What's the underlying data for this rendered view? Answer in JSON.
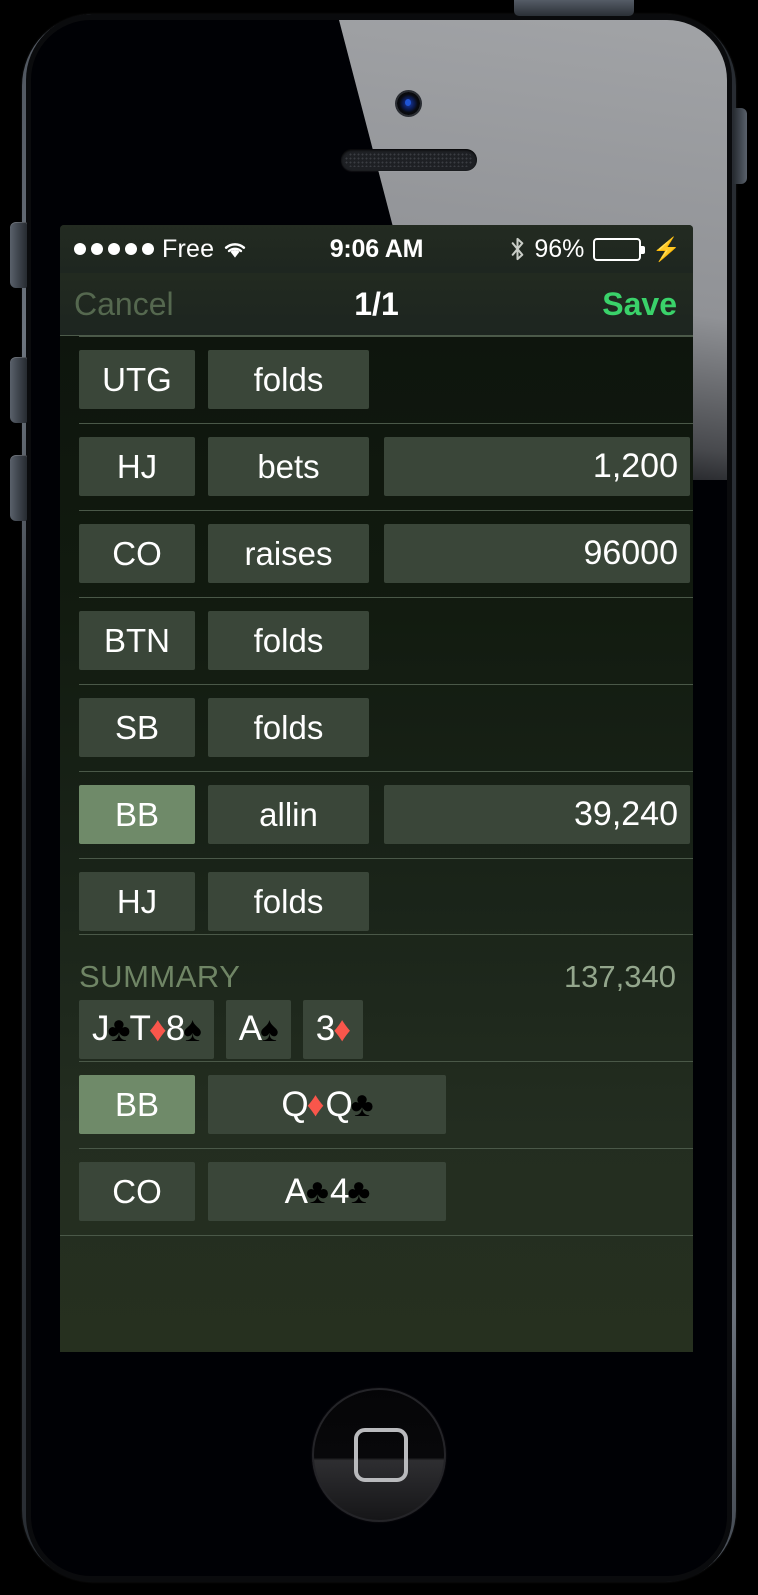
{
  "device": {
    "camera_icon": "front-camera",
    "speaker_icon": "earpiece-speaker",
    "home_icon": "home-square"
  },
  "status_bar": {
    "signal_dots": 5,
    "carrier": "Free",
    "wifi_icon": "wifi-icon",
    "time": "9:06 AM",
    "bluetooth_icon": "bluetooth-icon",
    "battery_percent": "96%",
    "battery_level": 96,
    "battery_color": "#4cd964",
    "charging_icon": "lightning-bolt-icon"
  },
  "nav_bar": {
    "cancel_label": "Cancel",
    "title": "1/1",
    "save_label": "Save",
    "save_color": "#3ad26a",
    "cancel_color": "#55684f"
  },
  "actions": [
    {
      "position": "UTG",
      "action": "folds",
      "amount": ""
    },
    {
      "position": "HJ",
      "action": "bets",
      "amount": "1,200"
    },
    {
      "position": "CO",
      "action": "raises",
      "amount": "96000"
    },
    {
      "position": "BTN",
      "action": "folds",
      "amount": ""
    },
    {
      "position": "SB",
      "action": "folds",
      "amount": ""
    },
    {
      "position": "BB",
      "action": "allin",
      "amount": "39,240",
      "highlighted": true
    },
    {
      "position": "HJ",
      "action": "folds",
      "amount": ""
    }
  ],
  "summary": {
    "label": "SUMMARY",
    "pot": "137,340",
    "board": [
      {
        "group": "flop",
        "cards": [
          {
            "rank": "J",
            "suit": "♣",
            "color": "black"
          },
          {
            "rank": "T",
            "suit": "♦",
            "color": "red"
          },
          {
            "rank": "8",
            "suit": "♠",
            "color": "black"
          }
        ]
      },
      {
        "group": "turn",
        "cards": [
          {
            "rank": "A",
            "suit": "♠",
            "color": "black"
          }
        ]
      },
      {
        "group": "river",
        "cards": [
          {
            "rank": "3",
            "suit": "♦",
            "color": "red"
          }
        ]
      }
    ],
    "showdown": [
      {
        "position": "BB",
        "highlighted": true,
        "cards": [
          {
            "rank": "Q",
            "suit": "♦",
            "color": "red"
          },
          {
            "rank": "Q",
            "suit": "♣",
            "color": "black"
          }
        ]
      },
      {
        "position": "CO",
        "highlighted": false,
        "cards": [
          {
            "rank": "A",
            "suit": "♣",
            "color": "black"
          },
          {
            "rank": "4",
            "suit": "♣",
            "color": "black"
          }
        ]
      }
    ]
  },
  "colors": {
    "chip_bg": "#3a4639",
    "chip_highlight": "#6f8a69",
    "separator": "#4a5848",
    "red_suit": "#f9564b",
    "black_suit": "#000000",
    "screen_bg": "#1b2319"
  }
}
